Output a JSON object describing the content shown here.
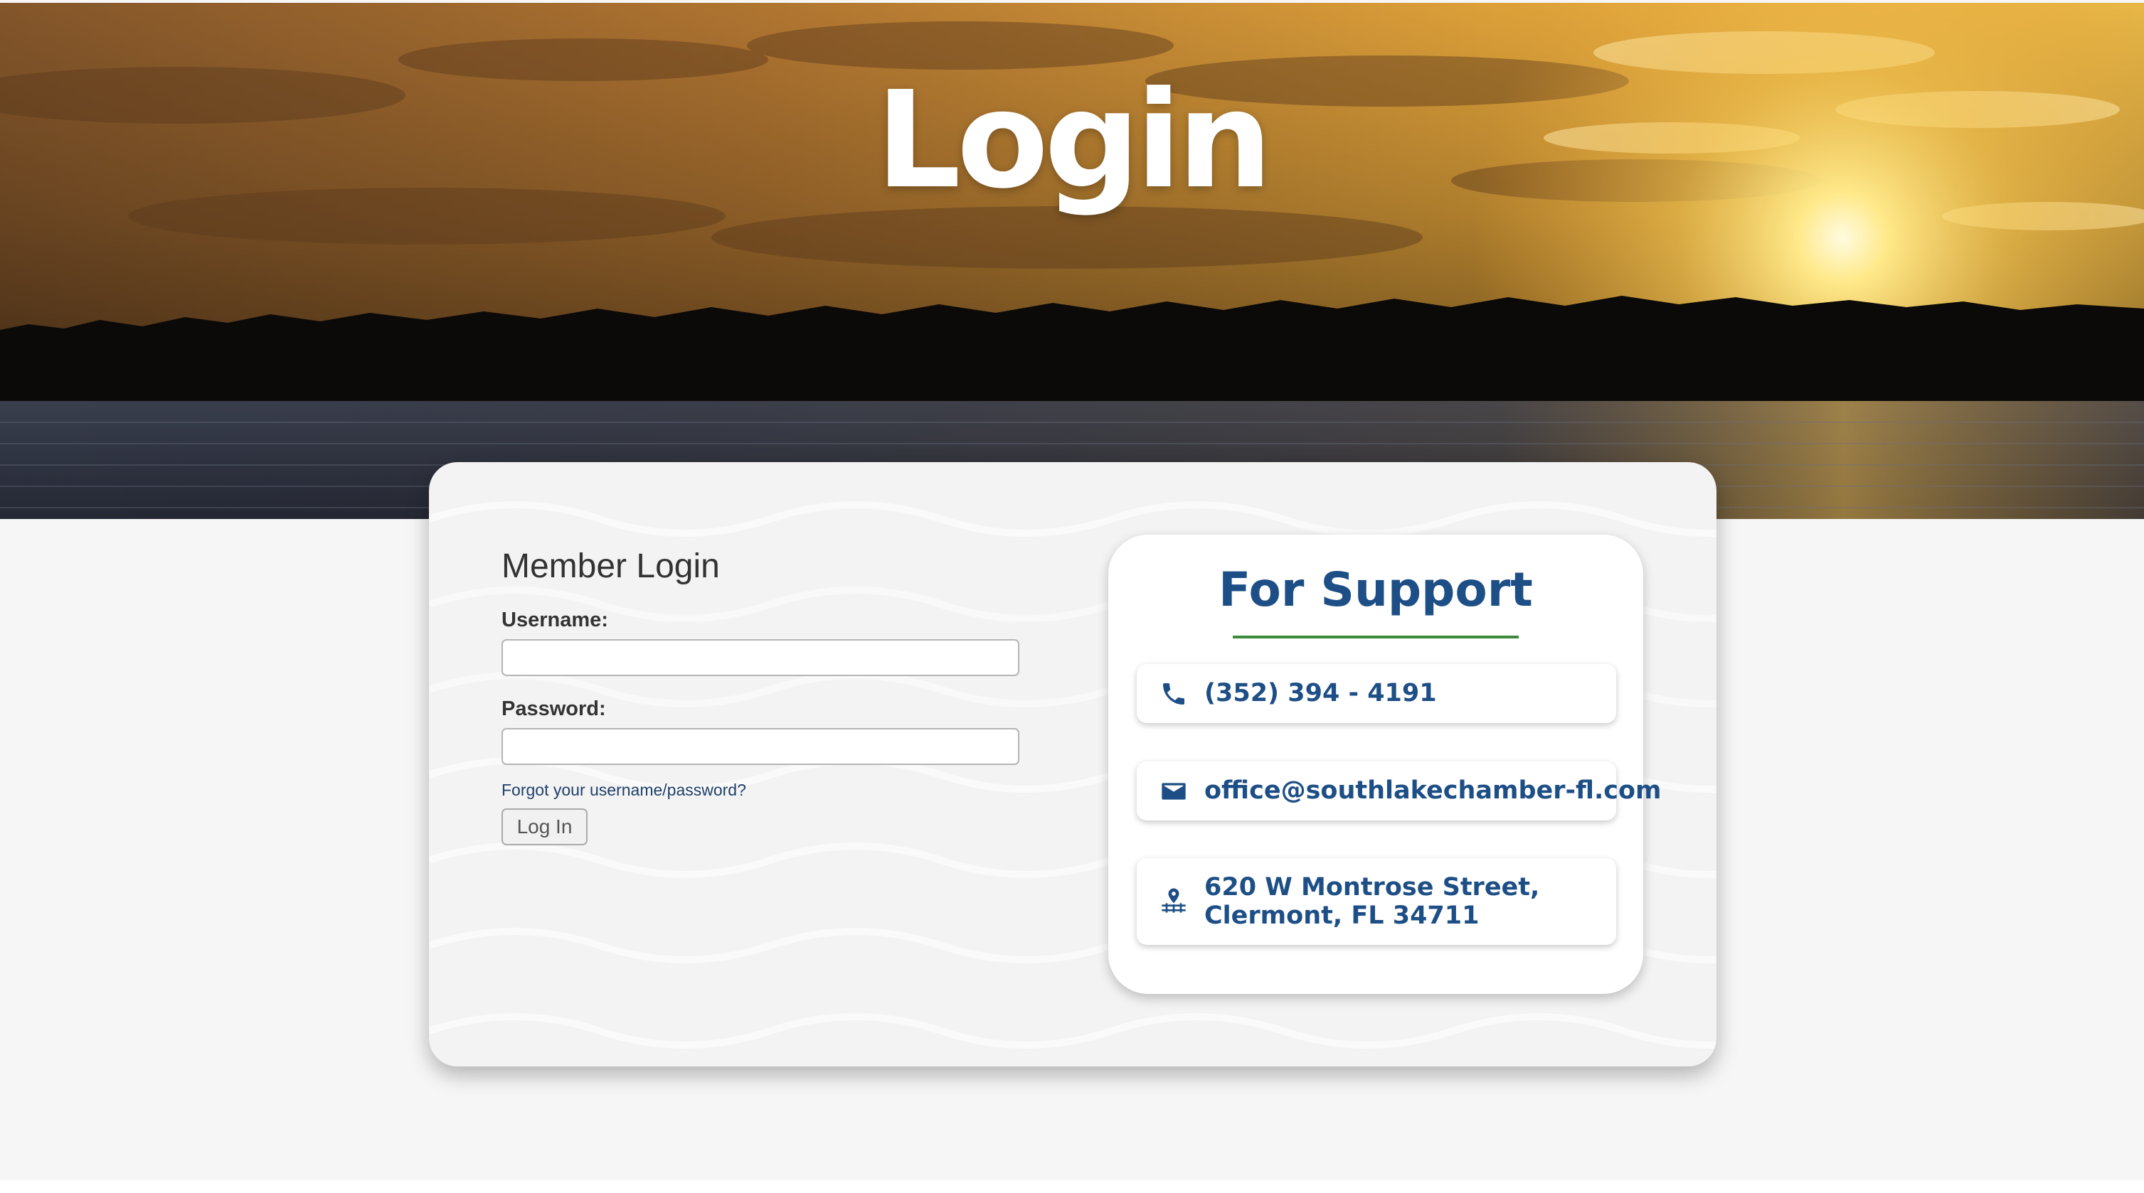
{
  "hero": {
    "title": "Login"
  },
  "login": {
    "heading": "Member Login",
    "username_label": "Username:",
    "username_value": "",
    "password_label": "Password:",
    "password_value": "",
    "forgot_link": "Forgot your username/password?",
    "submit_label": "Log In"
  },
  "support": {
    "title": "For Support",
    "phone": {
      "icon": "phone-icon",
      "text": "(352) 394 - 4191"
    },
    "email": {
      "icon": "mail-icon",
      "text": "office@southlakechamber-fl.com"
    },
    "address": {
      "icon": "map-pin-icon",
      "line1": "620 W Montrose Street,",
      "line2": "Clermont, FL 34711"
    }
  },
  "colors": {
    "brand_blue": "#1d4f86",
    "accent_green": "#3c8b3c",
    "page_background": "#f6f6f6"
  }
}
